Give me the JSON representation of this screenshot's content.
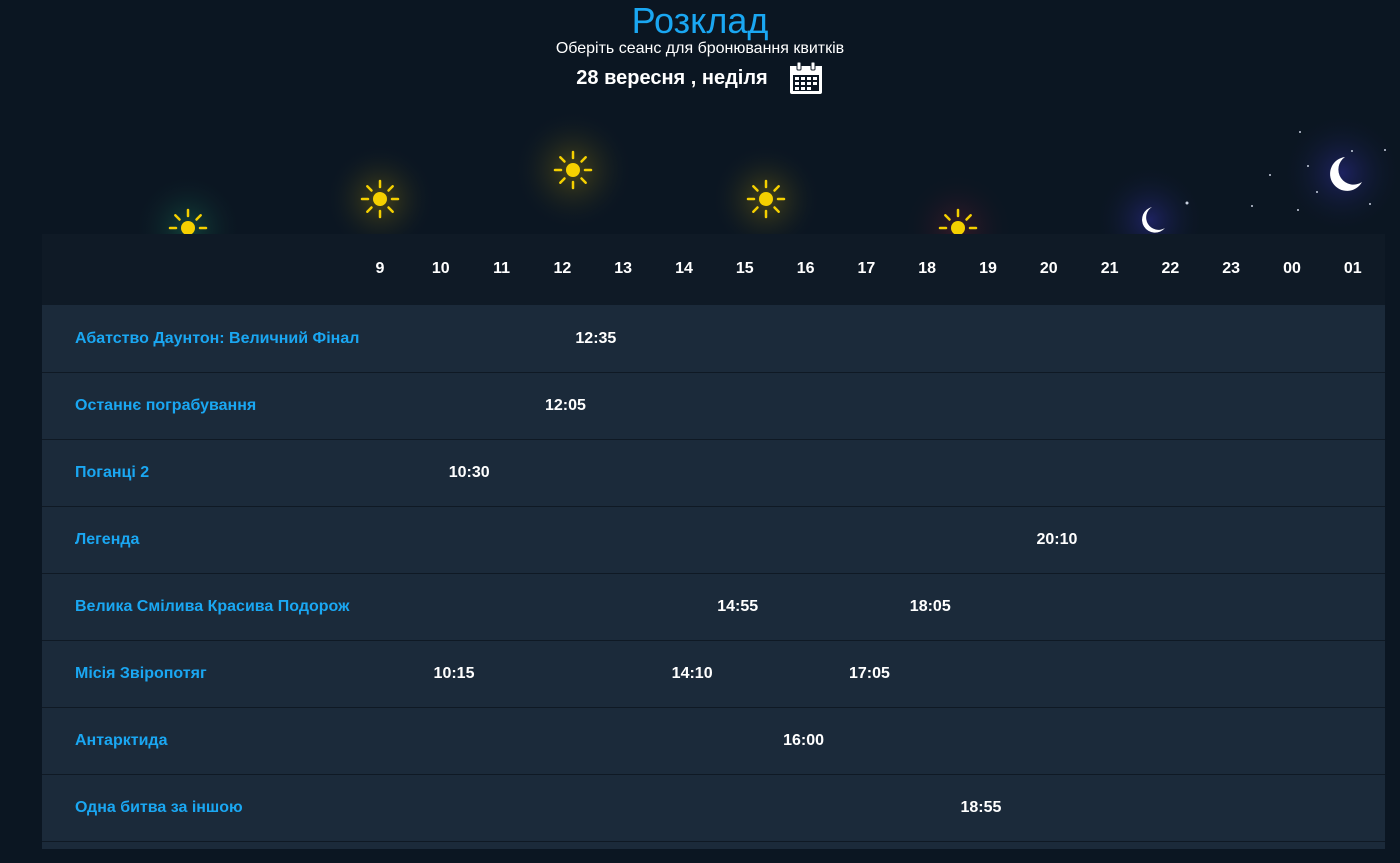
{
  "header": {
    "title": "Розклад",
    "subtitle": "Оберіть сеанс для бронювання квитків",
    "date": "28 вересня , неділя",
    "calendar_icon": "calendar-icon"
  },
  "sky": {
    "icons": [
      "sun-icon",
      "moon-icon"
    ],
    "sun_color": "#f5d000",
    "moon_color": "#ffffff"
  },
  "hours": [
    "9",
    "10",
    "11",
    "12",
    "13",
    "14",
    "15",
    "16",
    "17",
    "18",
    "19",
    "20",
    "21",
    "22",
    "23",
    "00",
    "01"
  ],
  "movies": [
    {
      "title": "Абатство Даунтон: Величний Фінал",
      "sessions": [
        "12:35"
      ]
    },
    {
      "title": "Останнє пограбування",
      "sessions": [
        "12:05"
      ]
    },
    {
      "title": "Поганці 2",
      "sessions": [
        "10:30"
      ]
    },
    {
      "title": "Легенда",
      "sessions": [
        "20:10"
      ]
    },
    {
      "title": "Велика Смілива Красива Подорож",
      "sessions": [
        "14:55",
        "18:05"
      ]
    },
    {
      "title": "Місія Звіропотяг",
      "sessions": [
        "10:15",
        "14:10",
        "17:05"
      ]
    },
    {
      "title": "Антарктида",
      "sessions": [
        "16:00"
      ]
    },
    {
      "title": "Одна битва за іншою",
      "sessions": [
        "18:55"
      ]
    }
  ],
  "colors": {
    "accent": "#1aa7f2",
    "background": "#0b1622",
    "row": "#1b2a3a",
    "header_row": "#0f1a26"
  }
}
